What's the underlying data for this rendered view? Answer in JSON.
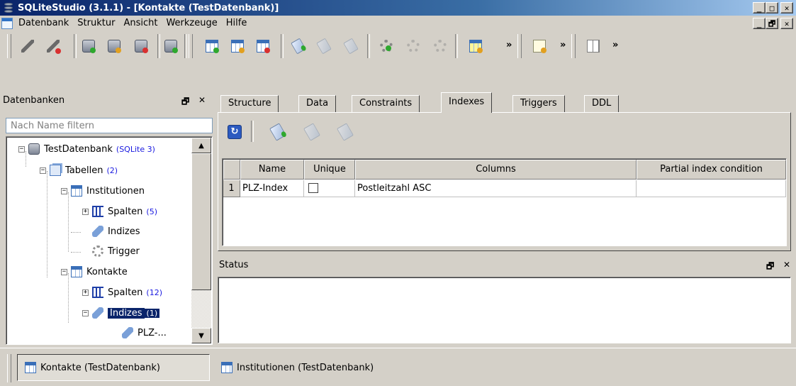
{
  "window": {
    "title": "SQLiteStudio (3.1.1) - [Kontakte (TestDatenbank)]",
    "controls": {
      "minimize": "_",
      "maximize": "□",
      "restore": "🗗",
      "close": "✕"
    }
  },
  "menu": {
    "items": [
      "Datenbank",
      "Struktur",
      "Ansicht",
      "Werkzeuge",
      "Hilfe"
    ]
  },
  "toolbar": {
    "icons": [
      "connect-icon",
      "disconnect-icon",
      "add-database-icon",
      "edit-database-icon",
      "delete-database-icon",
      "refresh-schema-icon",
      "add-table-icon",
      "edit-table-icon",
      "delete-table-icon",
      "add-index-icon",
      "edit-index-icon",
      "delete-index-icon",
      "add-trigger-icon",
      "edit-trigger-icon",
      "delete-trigger-icon",
      "import-icon",
      "sql-editor-icon",
      "window-list-icon"
    ],
    "overflow": "»"
  },
  "db_panel": {
    "title": "Datenbanken",
    "filter_placeholder": "Nach Name filtern",
    "float": "🗗",
    "close": "✕",
    "tree": {
      "database": "TestDatenbank",
      "database_note": "(SQLite 3)",
      "tables": "Tabellen",
      "tables_count": "(2)",
      "institutionen": "Institutionen",
      "inst_spalten": "Spalten",
      "inst_spalten_count": "(5)",
      "inst_indizes": "Indizes",
      "inst_trigger": "Trigger",
      "kontakte": "Kontakte",
      "kont_spalten": "Spalten",
      "kont_spalten_count": "(12)",
      "kont_indizes": "Indizes",
      "kont_indizes_count": "(1)",
      "kont_index_item": "PLZ-..."
    }
  },
  "tabs": {
    "items": [
      "Structure",
      "Data",
      "Constraints",
      "Indexes",
      "Triggers",
      "DDL"
    ],
    "active": "Indexes"
  },
  "index_grid": {
    "columns": [
      "Name",
      "Unique",
      "Columns",
      "Partial index condition"
    ],
    "rows": [
      {
        "num": "1",
        "name": "PLZ-Index",
        "unique": false,
        "columns": "Postleitzahl ASC",
        "condition": ""
      }
    ]
  },
  "status_panel": {
    "title": "Status",
    "float": "🗗",
    "close": "✕"
  },
  "windows": [
    {
      "label": "Kontakte (TestDatenbank)",
      "active": true
    },
    {
      "label": "Institutionen (TestDatenbank)",
      "active": false
    }
  ]
}
